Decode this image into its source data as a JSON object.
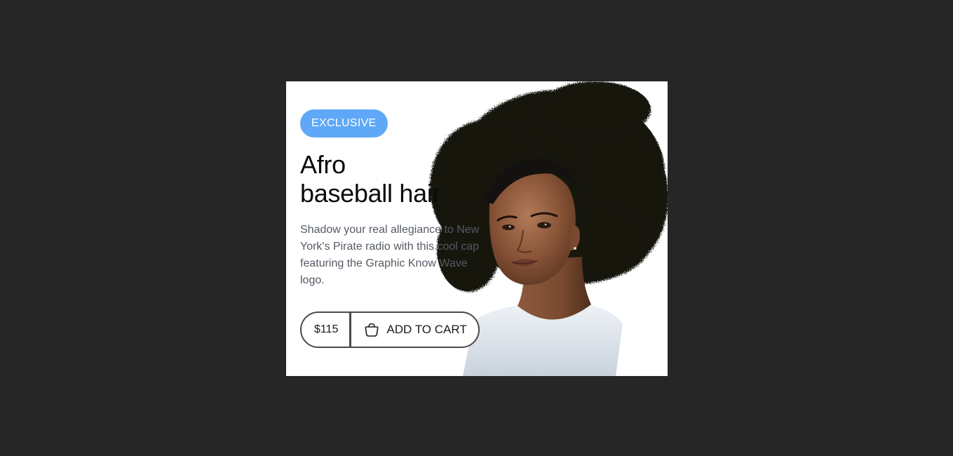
{
  "card": {
    "badge": "EXCLUSIVE",
    "title_line1": "Afro",
    "title_line2": "baseball hair",
    "description": "Shadow your real allegiance to New York's Pirate radio with this cool cap featuring the Graphic Know Wave logo.",
    "price": "$115",
    "add_to_cart_label": "ADD TO CART",
    "cart_icon": "shopping-bag-icon"
  },
  "colors": {
    "page_background": "#262626",
    "card_background": "#ffffff",
    "badge_background": "#5ea8f7",
    "title_text": "#0a0a0a",
    "description_text": "#555a63",
    "button_border": "#4a4a4a"
  }
}
